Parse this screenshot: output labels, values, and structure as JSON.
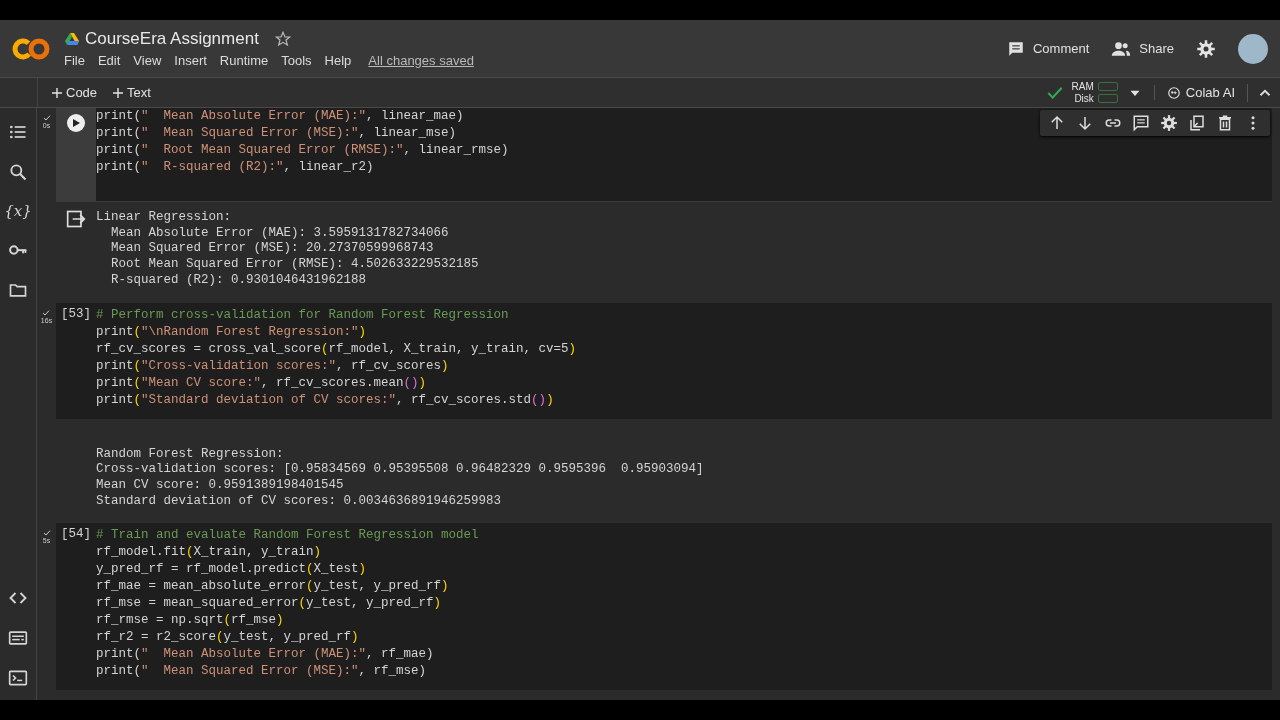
{
  "header": {
    "title": "CourseEra Assignment",
    "menu": [
      "File",
      "Edit",
      "View",
      "Insert",
      "Runtime",
      "Tools",
      "Help"
    ],
    "save_status": "All changes saved",
    "actions": [
      {
        "kind": "comment",
        "label": "Comment"
      },
      {
        "kind": "share",
        "label": "Share"
      }
    ]
  },
  "toolbar": {
    "add_buttons": [
      "Code",
      "Text"
    ],
    "resources": [
      "RAM",
      "Disk"
    ],
    "ai_button": "Colab AI"
  },
  "sidebar": {
    "top": [
      {
        "kind": "toc"
      },
      {
        "kind": "search"
      },
      {
        "kind": "variables",
        "label": "{x}"
      },
      {
        "kind": "key"
      },
      {
        "kind": "folder"
      }
    ],
    "bottom": [
      {
        "kind": "code"
      },
      {
        "kind": "form"
      },
      {
        "kind": "terminal"
      }
    ]
  },
  "cells": [
    {
      "selected": true,
      "run_time": "0s",
      "prompt": {
        "kind": "run"
      },
      "lines": [
        [
          {
            "kind": "plain",
            "text": "print("
          },
          {
            "kind": "string",
            "text": "\"  Mean Absolute Error (MAE):\""
          },
          {
            "kind": "plain",
            "text": ", linear_mae)"
          }
        ],
        [
          {
            "kind": "plain",
            "text": "print("
          },
          {
            "kind": "string",
            "text": "\"  Mean Squared Error (MSE):\""
          },
          {
            "kind": "plain",
            "text": ", linear_mse)"
          }
        ],
        [
          {
            "kind": "plain",
            "text": "print("
          },
          {
            "kind": "string",
            "text": "\"  Root Mean Squared Error (RMSE):\""
          },
          {
            "kind": "plain",
            "text": ", linear_rmse)"
          }
        ],
        [
          {
            "kind": "plain",
            "text": "print("
          },
          {
            "kind": "string",
            "text": "\"  R-squared (R2):\""
          },
          {
            "kind": "plain",
            "text": ", linear_r2)"
          }
        ]
      ],
      "output": {
        "show_icon": true,
        "lines": [
          "Linear Regression:",
          "  Mean Absolute Error (MAE): 3.5959131782734066",
          "  Mean Squared Error (MSE): 20.27370599968743",
          "  Root Mean Squared Error (RMSE): 4.502633229532185",
          "  R-squared (R2): 0.9301046431962188"
        ]
      }
    },
    {
      "selected": false,
      "run_time": "16s",
      "prompt": {
        "kind": "count",
        "text": "[53]"
      },
      "lines": [
        [
          {
            "kind": "comment",
            "text": "# Perform cross-validation for Random Forest Regression"
          }
        ],
        [
          {
            "kind": "plain",
            "text": "print"
          },
          {
            "kind": "bracket",
            "text": "("
          },
          {
            "kind": "string",
            "text": "\"\\nRandom Forest Regression:\""
          },
          {
            "kind": "bracket",
            "text": ")"
          }
        ],
        [
          {
            "kind": "plain",
            "text": "rf_cv_scores = cross_val_score"
          },
          {
            "kind": "bracket",
            "text": "("
          },
          {
            "kind": "plain",
            "text": "rf_model, X_train, y_train, cv=5"
          },
          {
            "kind": "bracket",
            "text": ")"
          }
        ],
        [
          {
            "kind": "plain",
            "text": "print"
          },
          {
            "kind": "bracket",
            "text": "("
          },
          {
            "kind": "string",
            "text": "\"Cross-validation scores:\""
          },
          {
            "kind": "plain",
            "text": ", rf_cv_scores"
          },
          {
            "kind": "bracket",
            "text": ")"
          }
        ],
        [
          {
            "kind": "plain",
            "text": "print"
          },
          {
            "kind": "bracket",
            "text": "("
          },
          {
            "kind": "string",
            "text": "\"Mean CV score:\""
          },
          {
            "kind": "plain",
            "text": ", rf_cv_scores.mean"
          },
          {
            "kind": "bracket2",
            "text": "()"
          },
          {
            "kind": "bracket",
            "text": ")"
          }
        ],
        [
          {
            "kind": "plain",
            "text": "print"
          },
          {
            "kind": "bracket",
            "text": "("
          },
          {
            "kind": "string",
            "text": "\"Standard deviation of CV scores:\""
          },
          {
            "kind": "plain",
            "text": ", rf_cv_scores.std"
          },
          {
            "kind": "bracket2",
            "text": "()"
          },
          {
            "kind": "bracket",
            "text": ")"
          }
        ]
      ],
      "output": {
        "show_icon": false,
        "lines": [
          "Random Forest Regression:",
          "Cross-validation scores: [0.95834569 0.95395508 0.96482329 0.9595396  0.95903094]",
          "Mean CV score: 0.9591389198401545",
          "Standard deviation of CV scores: 0.0034636891946259983"
        ]
      }
    },
    {
      "selected": false,
      "run_time": "5s",
      "prompt": {
        "kind": "count",
        "text": "[54]"
      },
      "lines": [
        [
          {
            "kind": "comment",
            "text": "# Train and evaluate Random Forest Regression model"
          }
        ],
        [
          {
            "kind": "plain",
            "text": "rf_model.fit"
          },
          {
            "kind": "bracket",
            "text": "("
          },
          {
            "kind": "plain",
            "text": "X_train, y_train"
          },
          {
            "kind": "bracket",
            "text": ")"
          }
        ],
        [
          {
            "kind": "plain",
            "text": "y_pred_rf = rf_model.predict"
          },
          {
            "kind": "bracket",
            "text": "("
          },
          {
            "kind": "plain",
            "text": "X_test"
          },
          {
            "kind": "bracket",
            "text": ")"
          }
        ],
        [
          {
            "kind": "plain",
            "text": "rf_mae = mean_absolute_error"
          },
          {
            "kind": "bracket",
            "text": "("
          },
          {
            "kind": "plain",
            "text": "y_test, y_pred_rf"
          },
          {
            "kind": "bracket",
            "text": ")"
          }
        ],
        [
          {
            "kind": "plain",
            "text": "rf_mse = mean_squared_error"
          },
          {
            "kind": "bracket",
            "text": "("
          },
          {
            "kind": "plain",
            "text": "y_test, y_pred_rf"
          },
          {
            "kind": "bracket",
            "text": ")"
          }
        ],
        [
          {
            "kind": "plain",
            "text": "rf_rmse = np.sqrt"
          },
          {
            "kind": "bracket",
            "text": "("
          },
          {
            "kind": "plain",
            "text": "rf_mse"
          },
          {
            "kind": "bracket",
            "text": ")"
          }
        ],
        [
          {
            "kind": "plain",
            "text": "rf_r2 = r2_score"
          },
          {
            "kind": "bracket",
            "text": "("
          },
          {
            "kind": "plain",
            "text": "y_test, y_pred_rf"
          },
          {
            "kind": "bracket",
            "text": ")"
          }
        ],
        [
          {
            "kind": "plain",
            "text": "print("
          },
          {
            "kind": "string",
            "text": "\"  Mean Absolute Error (MAE):\""
          },
          {
            "kind": "plain",
            "text": ", rf_mae)"
          }
        ],
        [
          {
            "kind": "plain",
            "text": "print("
          },
          {
            "kind": "string",
            "text": "\"  Mean Squared Error (MSE):\""
          },
          {
            "kind": "plain",
            "text": ", rf_mse)"
          }
        ]
      ]
    }
  ]
}
